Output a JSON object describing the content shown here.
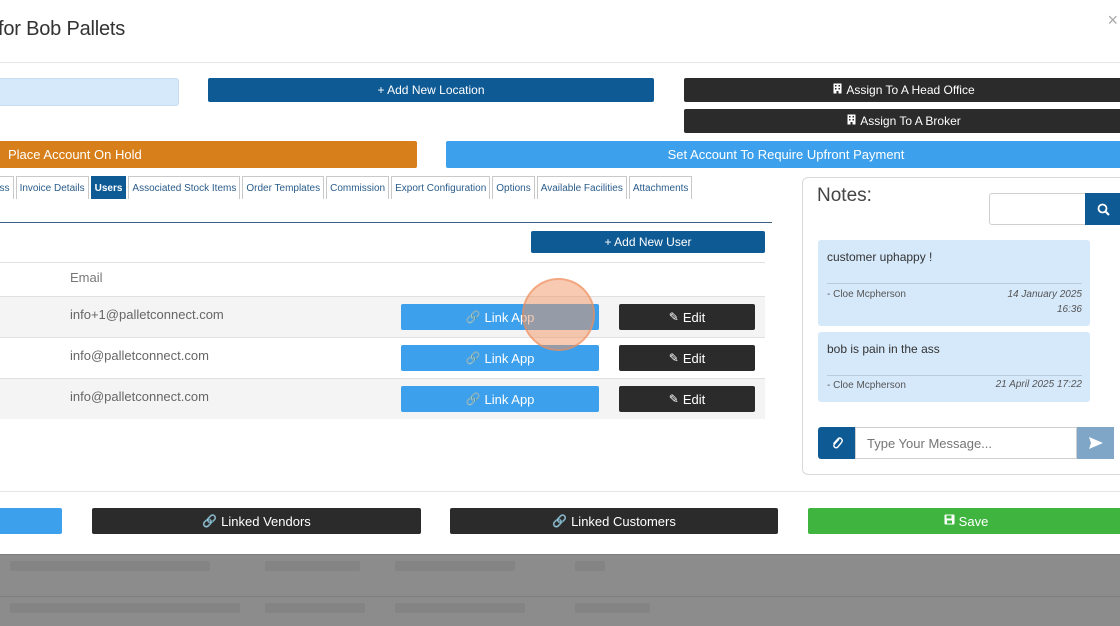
{
  "modal": {
    "title": "for Bob Pallets",
    "close_glyph": "×"
  },
  "actions": {
    "add_location": "+ Add New Location",
    "assign_head_office": "Assign To A Head Office",
    "assign_broker": "Assign To A Broker",
    "place_on_hold": "Place Account On Hold",
    "require_upfront": "Set Account To Require Upfront Payment"
  },
  "tabs": [
    {
      "label": "ess",
      "active": false
    },
    {
      "label": "Invoice Details",
      "active": false
    },
    {
      "label": "Users",
      "active": true
    },
    {
      "label": "Associated Stock Items",
      "active": false
    },
    {
      "label": "Order Templates",
      "active": false
    },
    {
      "label": "Commission",
      "active": false
    },
    {
      "label": "Export Configuration",
      "active": false
    },
    {
      "label": "Options",
      "active": false
    },
    {
      "label": "Available Facilities",
      "active": false
    },
    {
      "label": "Attachments",
      "active": false
    }
  ],
  "users": {
    "add_user_label": "+ Add New User",
    "email_header": "Email",
    "link_label": "Link App",
    "edit_label": "Edit",
    "rows": [
      {
        "email": "info+1@palletconnect.com"
      },
      {
        "email": "info@palletconnect.com"
      },
      {
        "email": "info@palletconnect.com"
      }
    ]
  },
  "notes": {
    "title": "Notes:",
    "search_value": "",
    "message_placeholder": "Type Your Message...",
    "items": [
      {
        "text": "customer uphappy !",
        "author": "- Cloe Mcpherson",
        "date_line1": "14 January 2025",
        "date_line2": "16:36"
      },
      {
        "text": "bob is pain in the ass",
        "author": "- Cloe Mcpherson",
        "date_line1": "21 April 2025 17:22",
        "date_line2": ""
      }
    ]
  },
  "footer": {
    "linked_vendors": "Linked Vendors",
    "linked_customers": "Linked Customers",
    "save": "Save"
  },
  "colors": {
    "primary": "#0e5a94",
    "info": "#3da0ec",
    "dark": "#2b2b2b",
    "warning": "#d77f1a",
    "success": "#3fb53f",
    "note_bg": "#d6e9fb"
  }
}
